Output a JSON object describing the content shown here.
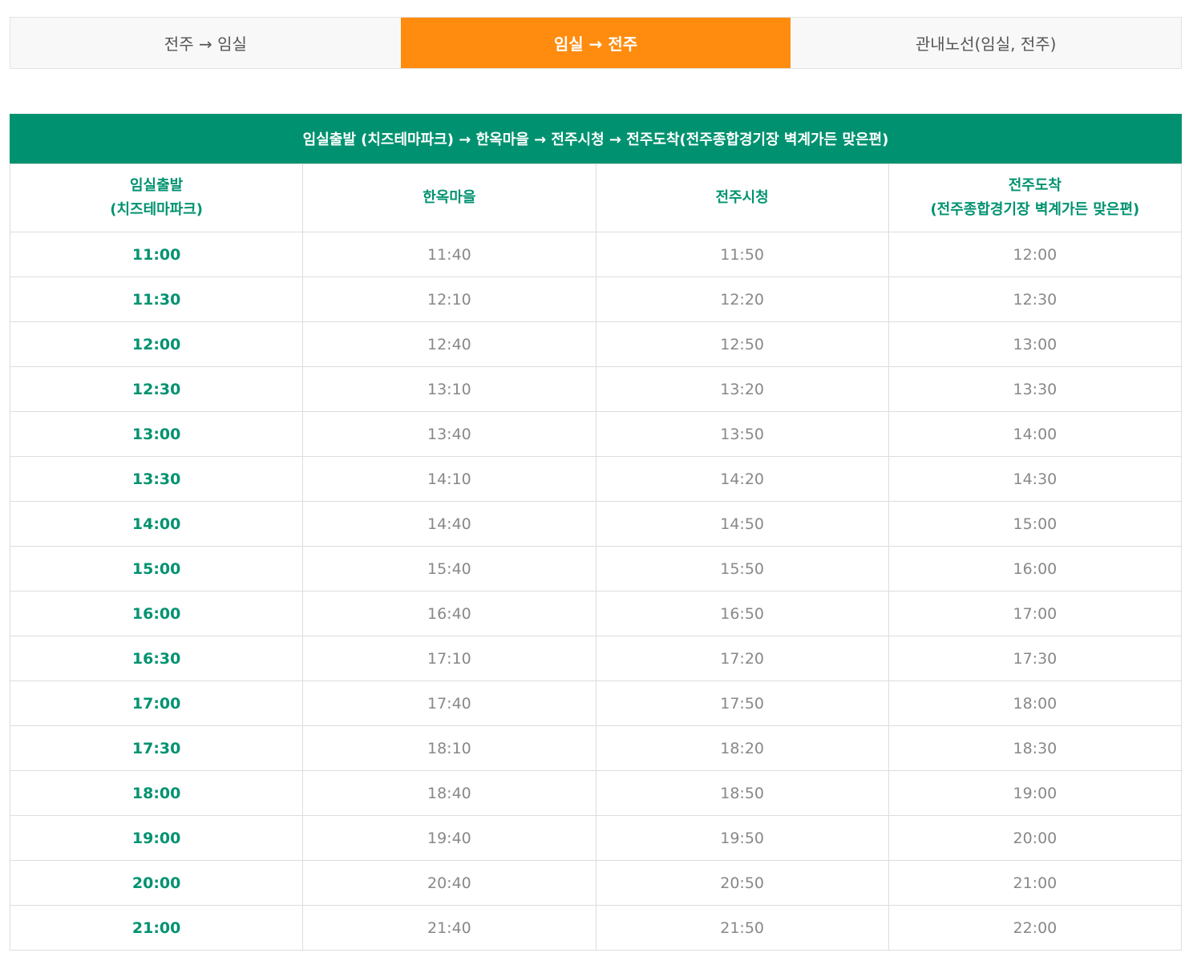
{
  "tabs": [
    {
      "label": "전주 → 임실",
      "active": false
    },
    {
      "label": "임실 → 전주",
      "active": true
    },
    {
      "label": "관내노선(임실, 전주)",
      "active": false
    }
  ],
  "route_title": "임실출발 (치즈테마파크) → 한옥마을 → 전주시청 → 전주도착(전주종합경기장 벽계가든 맞은편)",
  "columns": [
    {
      "line1": "임실출발",
      "line2": "(치즈테마파크)"
    },
    {
      "line1": "한옥마을",
      "line2": ""
    },
    {
      "line1": "전주시청",
      "line2": ""
    },
    {
      "line1": "전주도착",
      "line2": "(전주종합경기장 벽계가든 맞은편)"
    }
  ],
  "rows": [
    [
      "11:00",
      "11:40",
      "11:50",
      "12:00"
    ],
    [
      "11:30",
      "12:10",
      "12:20",
      "12:30"
    ],
    [
      "12:00",
      "12:40",
      "12:50",
      "13:00"
    ],
    [
      "12:30",
      "13:10",
      "13:20",
      "13:30"
    ],
    [
      "13:00",
      "13:40",
      "13:50",
      "14:00"
    ],
    [
      "13:30",
      "14:10",
      "14:20",
      "14:30"
    ],
    [
      "14:00",
      "14:40",
      "14:50",
      "15:00"
    ],
    [
      "15:00",
      "15:40",
      "15:50",
      "16:00"
    ],
    [
      "16:00",
      "16:40",
      "16:50",
      "17:00"
    ],
    [
      "16:30",
      "17:10",
      "17:20",
      "17:30"
    ],
    [
      "17:00",
      "17:40",
      "17:50",
      "18:00"
    ],
    [
      "17:30",
      "18:10",
      "18:20",
      "18:30"
    ],
    [
      "18:00",
      "18:40",
      "18:50",
      "19:00"
    ],
    [
      "19:00",
      "19:40",
      "19:50",
      "20:00"
    ],
    [
      "20:00",
      "20:40",
      "20:50",
      "21:00"
    ],
    [
      "21:00",
      "21:40",
      "21:50",
      "22:00"
    ]
  ],
  "colors": {
    "accent_orange": "#ff8c0f",
    "accent_green": "#009270",
    "muted_text": "#888888"
  }
}
